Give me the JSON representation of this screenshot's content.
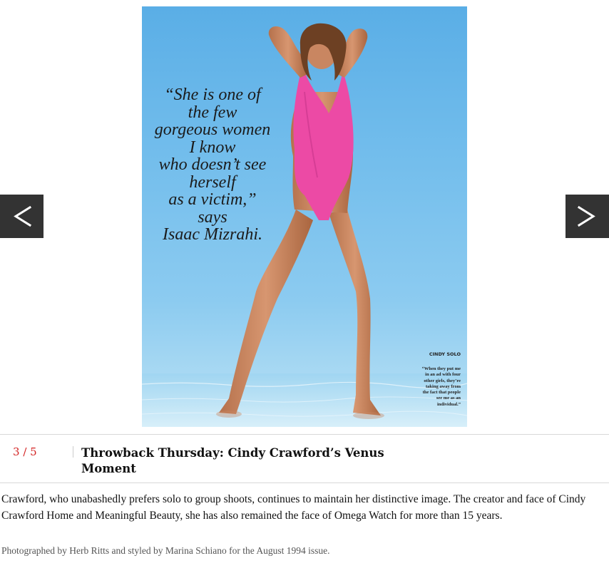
{
  "gallery": {
    "photo": {
      "quote_lines": [
        "“She is one of",
        "the few",
        "gorgeous women",
        "I know",
        "who doesn’t see",
        "herself",
        "as a victim,”",
        "says",
        "Isaac Mizrahi."
      ],
      "sidebar_title": "CINDY SOLO",
      "sidebar_text": "“When they put me in an ad with four other girls, they’re taking away from the fact that people see me as an individual.”",
      "swimsuit_color": "#ec4aa5",
      "sky_color": "#6bb8ea"
    },
    "nav": {
      "prev_icon": "chevron-left-icon",
      "next_icon": "chevron-right-icon",
      "button_color": "#333333"
    },
    "counter": {
      "current": "3",
      "separator": "/",
      "total": "5",
      "color": "#d32323"
    },
    "title": "Throwback Thursday: Cindy Crawford’s Venus Moment",
    "caption": "Crawford, who unabashedly prefers solo to group shoots, continues to maintain her distinctive image. The creator and face of Cindy Crawford Home and Meaningful Beauty, she has also remained the face of Omega Watch for more than 15 years.",
    "credit": "Photographed by Herb Ritts and styled by Marina Schiano for the August 1994 issue."
  }
}
